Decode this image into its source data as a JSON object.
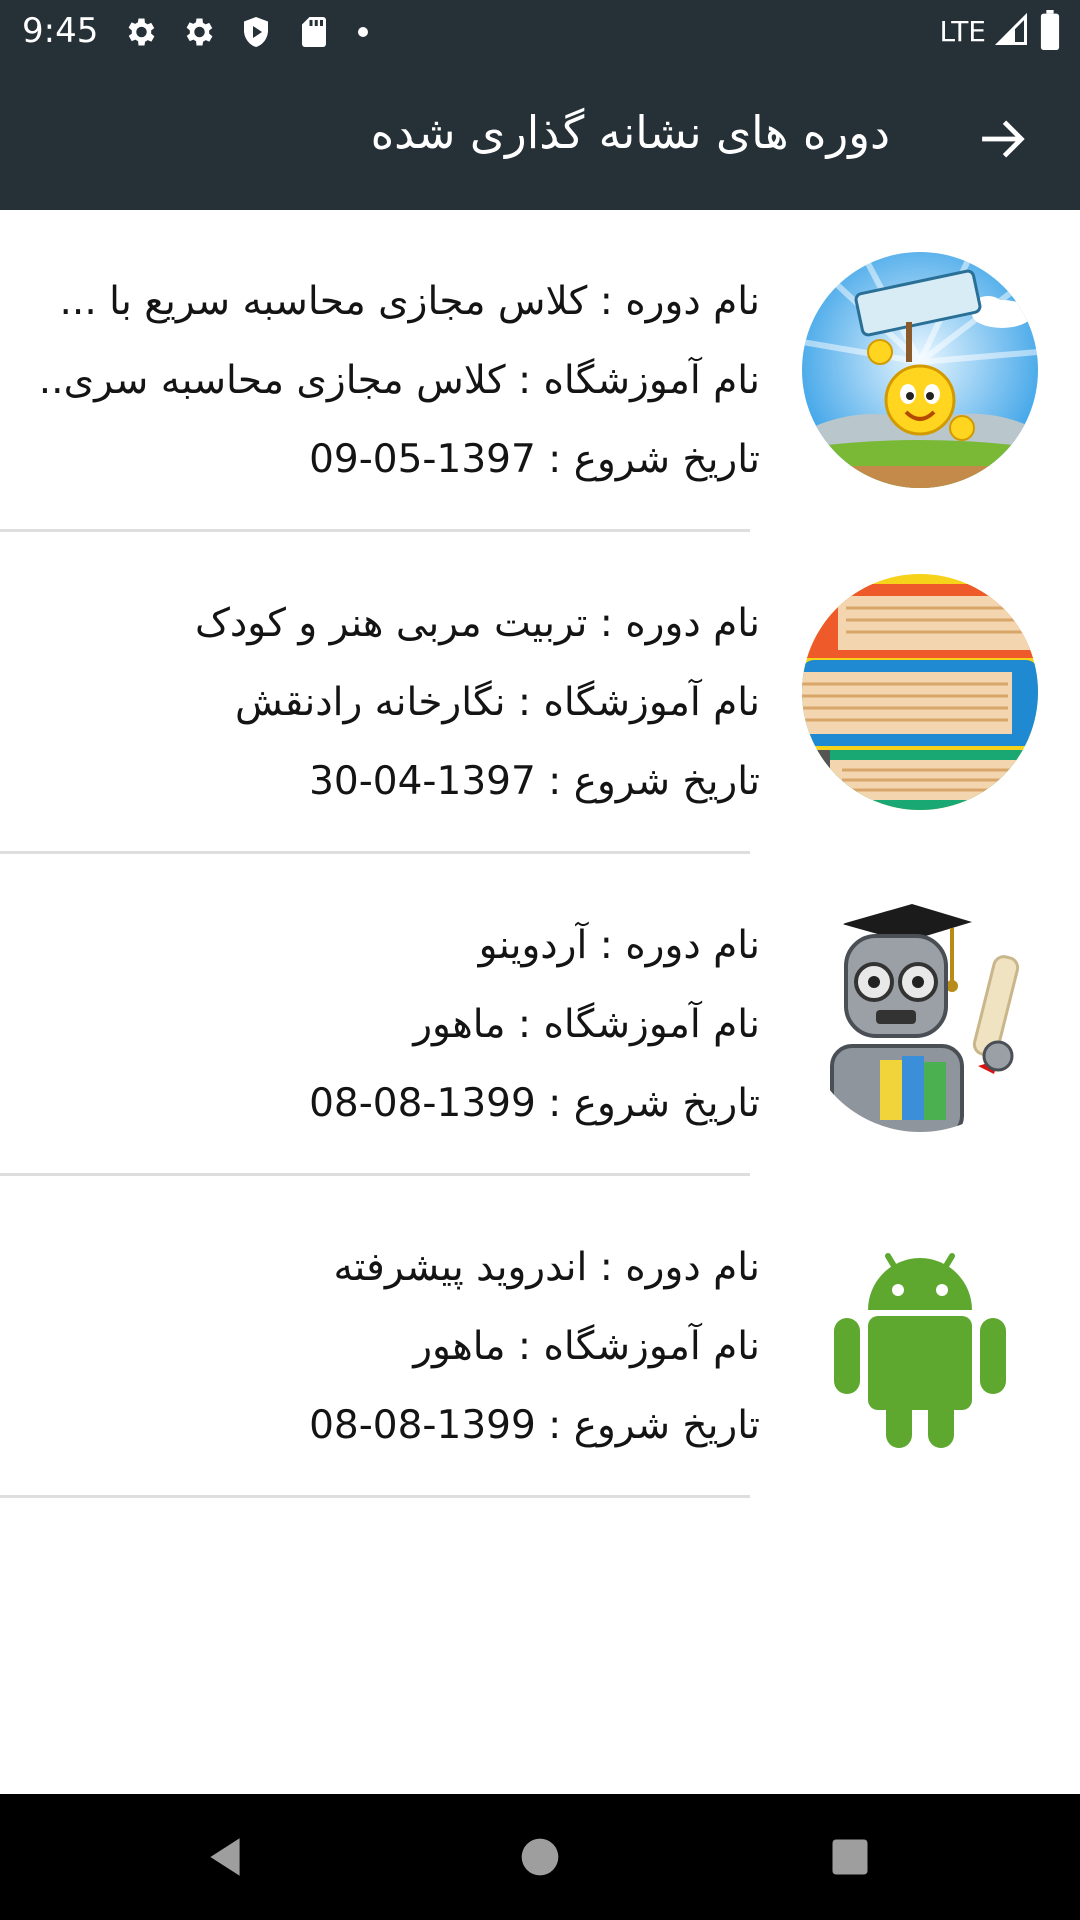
{
  "status_bar": {
    "time": "9:45",
    "network": "LTE",
    "icons": [
      "gear-icon",
      "gear-icon",
      "shield-icon",
      "sd-card-icon",
      "dot-icon",
      "signal-icon",
      "battery-icon"
    ]
  },
  "app_bar": {
    "title": "دوره های نشانه گذاری شده",
    "back_icon": "arrow-right-icon"
  },
  "colors": {
    "app_bar": "#263037",
    "text": "#141414",
    "divider": "#dedede",
    "nav_bar": "#000000"
  },
  "courses": [
    {
      "course_name": "نام دوره : کلاس مجازی محاسبه سریع با ...",
      "institute_name": "نام آموزشگاه : کلاس مجازی محاسبه سری..",
      "start_date": "تاریخ شروع : 1397-05-09",
      "image_icon": "calculation-station-icon"
    },
    {
      "course_name": "نام دوره : تربیت مربی هنر و کودک",
      "institute_name": "نام آموزشگاه : نگارخانه رادنقش",
      "start_date": "تاریخ شروع : 1397-04-30",
      "image_icon": "book-stack-icon"
    },
    {
      "course_name": "نام دوره : آردوینو",
      "institute_name": "نام آموزشگاه : ماهور",
      "start_date": "تاریخ شروع : 1399-08-08",
      "image_icon": "graduate-robot-icon"
    },
    {
      "course_name": "نام دوره : اندروید پیشرفته",
      "institute_name": "نام آموزشگاه : ماهور",
      "start_date": "تاریخ شروع : 1399-08-08",
      "image_icon": "android-icon"
    }
  ],
  "nav_bar": {
    "back": "nav-back-icon",
    "home": "nav-home-icon",
    "recents": "nav-recents-icon"
  }
}
